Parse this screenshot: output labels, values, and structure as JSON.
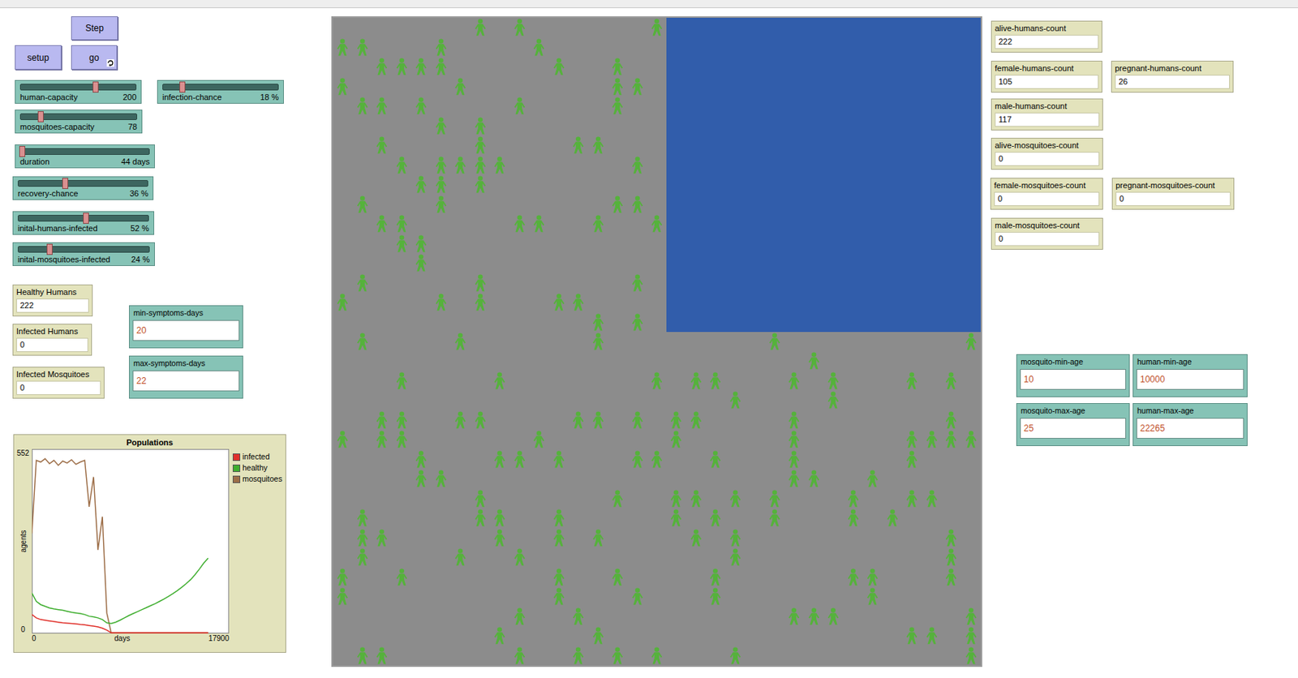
{
  "buttons": [
    {
      "label": "Step",
      "forever": false
    },
    {
      "label": "setup",
      "forever": false
    },
    {
      "label": "go",
      "forever": true
    }
  ],
  "sliders": [
    {
      "name": "human-capacity",
      "reading": "200",
      "level": 0.65
    },
    {
      "name": "infection-chance",
      "reading": "18 %",
      "level": 0.17
    },
    {
      "name": "mosquitoes-capacity",
      "reading": "78",
      "level": 0.17
    },
    {
      "name": "duration",
      "reading": "44 days",
      "level": 0.01
    },
    {
      "name": "recovery-chance",
      "reading": "36 %",
      "level": 0.36
    },
    {
      "name": "inital-humans-infected",
      "reading": "52 %",
      "level": 0.52
    },
    {
      "name": "inital-mosquitoes-infected",
      "reading": "24 %",
      "level": 0.24
    }
  ],
  "monitors": [
    {
      "label": "Healthy Humans",
      "value": "222"
    },
    {
      "label": "Infected Humans",
      "value": "0"
    },
    {
      "label": "Infected Mosquitoes",
      "value": "0"
    }
  ],
  "inputs": [
    {
      "label": "min-symptoms-days",
      "value": "20"
    },
    {
      "label": "max-symptoms-days",
      "value": "22"
    }
  ],
  "plot": {
    "title": "Populations",
    "y_label": "agents",
    "x_label": "days",
    "y_max": "552",
    "y_min": "0",
    "x_min": "0",
    "x_max": "17900",
    "series": [
      {
        "name": "infected",
        "color": "#e0312b",
        "values": [
          55,
          45,
          40,
          38,
          36,
          34,
          32,
          30,
          29,
          28,
          27,
          25,
          24,
          22,
          20,
          18,
          14,
          8,
          0,
          0,
          0,
          0,
          0,
          0,
          0,
          0,
          0,
          0,
          0,
          0,
          0,
          0,
          0,
          0,
          0,
          0,
          0,
          0,
          0,
          0,
          0
        ]
      },
      {
        "name": "healthy",
        "color": "#3fae2f",
        "values": [
          120,
          95,
          85,
          80,
          75,
          72,
          70,
          68,
          65,
          62,
          60,
          58,
          55,
          50,
          48,
          45,
          40,
          30,
          28,
          32,
          38,
          45,
          52,
          58,
          64,
          70,
          76,
          82,
          88,
          95,
          102,
          110,
          118,
          127,
          137,
          148,
          160,
          175,
          192,
          210,
          225
        ]
      },
      {
        "name": "mosquitoes",
        "color": "#9d6e48",
        "values": [
          300,
          520,
          515,
          525,
          510,
          520,
          505,
          518,
          512,
          522,
          508,
          515,
          520,
          380,
          470,
          250,
          350,
          60,
          0,
          0,
          0,
          0,
          0,
          0,
          0,
          0,
          0,
          0,
          0,
          0,
          0,
          0,
          0,
          0,
          0,
          0,
          0,
          0,
          0,
          0,
          0
        ]
      }
    ]
  },
  "world": {
    "water_region": true,
    "human_figures": 175
  },
  "right_monitors": [
    {
      "label": "alive-humans-count",
      "value": "222"
    },
    {
      "label": "female-humans-count",
      "value": "105"
    },
    {
      "label": "pregnant-humans-count",
      "value": "26"
    },
    {
      "label": "male-humans-count",
      "value": "117"
    },
    {
      "label": "alive-mosquitoes-count",
      "value": "0"
    },
    {
      "label": "female-mosquitoes-count",
      "value": "0"
    },
    {
      "label": "pregnant-mosquitoes-count",
      "value": "0"
    },
    {
      "label": "male-mosquitoes-count",
      "value": "0"
    }
  ],
  "right_inputs": [
    {
      "label": "mosquito-min-age",
      "value": "10"
    },
    {
      "label": "human-min-age",
      "value": "10000"
    },
    {
      "label": "mosquito-max-age",
      "value": "25"
    },
    {
      "label": "human-max-age",
      "value": "22265"
    }
  ]
}
